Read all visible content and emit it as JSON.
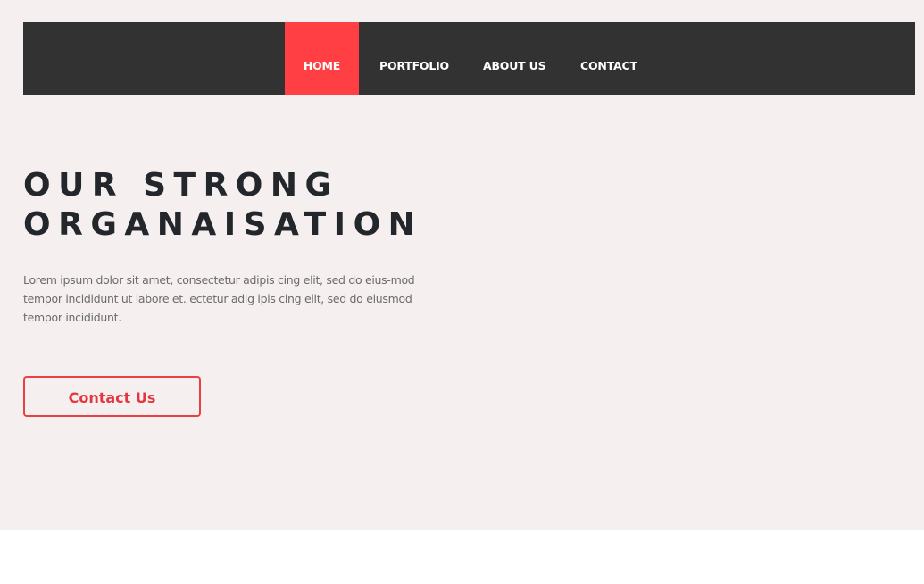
{
  "nav": {
    "items": [
      {
        "label": "HOME",
        "active": true
      },
      {
        "label": "PORTFOLIO",
        "active": false
      },
      {
        "label": "ABOUT US",
        "active": false
      },
      {
        "label": "CONTACT",
        "active": false
      }
    ]
  },
  "hero": {
    "title_line_1": "OUR STRONG",
    "title_line_2": "ORGANAISATION",
    "description": "Lorem ipsum dolor sit amet, consectetur adipis cing elit, sed do eius-mod tempor incididunt ut labore et. ectetur adig ipis cing elit, sed do eiusmod tempor incididunt.",
    "button_label": "Contact Us"
  },
  "colors": {
    "hero_background": "#f5f0ef",
    "navbar_background": "#323232",
    "accent": "#ff3f44",
    "title": "#23262b",
    "body_text": "#6b6b6b"
  }
}
